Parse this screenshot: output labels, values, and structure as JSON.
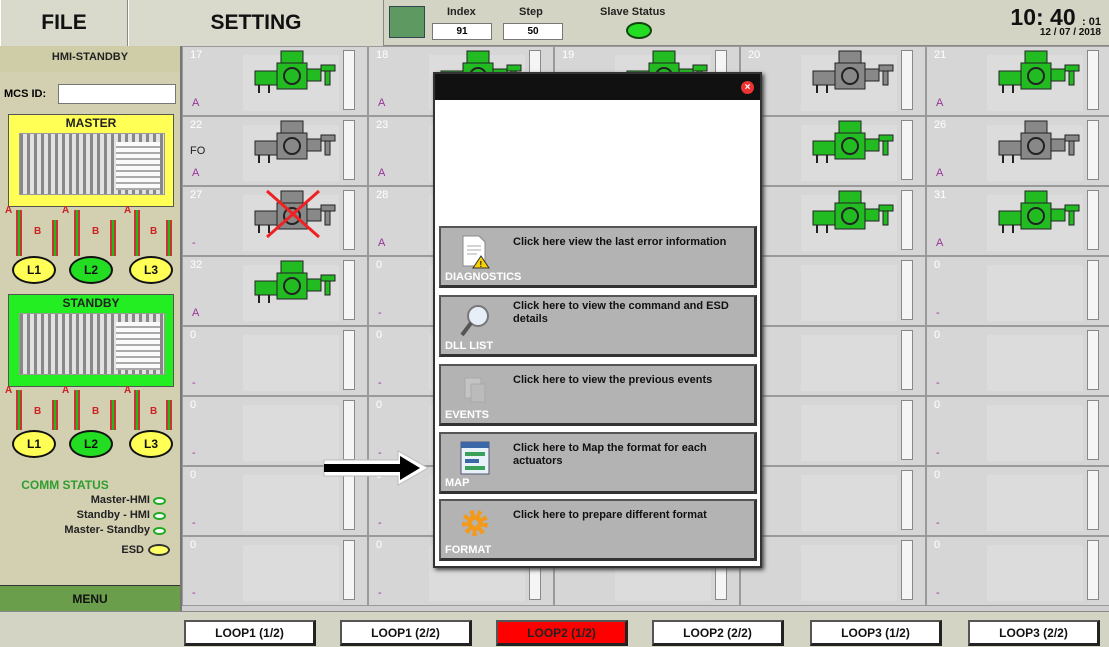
{
  "header": {
    "file_label": "FILE",
    "setting_label": "SETTING",
    "index_label": "Index",
    "index_value": "91",
    "step_label": "Step",
    "step_value": "50",
    "slave_status_label": "Slave Status",
    "time": "10: 40",
    "seconds": ": 01",
    "date": "12 / 07 / 2018"
  },
  "left_panel": {
    "title": "HMI-STANDBY",
    "mcs_label": "MCS ID:",
    "mcs_value": "",
    "master_label": "MASTER",
    "standby_label": "STANDBY",
    "a_label": "A",
    "b_label": "B",
    "loops": [
      "L1",
      "L2",
      "L3"
    ],
    "comm_status_title": "COMM STATUS",
    "comm_rows": [
      "Master-HMI",
      "Standby - HMI",
      "Master- Standby",
      "ESD"
    ],
    "menu_label": "MENU"
  },
  "grid": {
    "cells": [
      {
        "num": "17",
        "status": "A",
        "fo": "",
        "icon": "green"
      },
      {
        "num": "18",
        "status": "A",
        "fo": "",
        "icon": "green"
      },
      {
        "num": "19",
        "status": "",
        "fo": "",
        "icon": "green"
      },
      {
        "num": "20",
        "status": "",
        "fo": "",
        "icon": "gray"
      },
      {
        "num": "21",
        "status": "A",
        "fo": "",
        "icon": "green"
      },
      {
        "num": "22",
        "status": "A",
        "fo": "FO",
        "icon": "gray"
      },
      {
        "num": "23",
        "status": "A",
        "fo": "",
        "icon": ""
      },
      {
        "num": "",
        "status": "",
        "fo": "",
        "icon": ""
      },
      {
        "num": "",
        "status": "",
        "fo": "",
        "icon": "green"
      },
      {
        "num": "26",
        "status": "A",
        "fo": "",
        "icon": "gray"
      },
      {
        "num": "27",
        "status": "-",
        "fo": "",
        "icon": "crossed"
      },
      {
        "num": "28",
        "status": "A",
        "fo": "",
        "icon": ""
      },
      {
        "num": "",
        "status": "",
        "fo": "",
        "icon": ""
      },
      {
        "num": "",
        "status": "",
        "fo": "",
        "icon": "green"
      },
      {
        "num": "31",
        "status": "A",
        "fo": "",
        "icon": "green"
      },
      {
        "num": "32",
        "status": "A",
        "fo": "",
        "icon": "green"
      },
      {
        "num": "0",
        "status": "-",
        "fo": "",
        "icon": ""
      },
      {
        "num": "",
        "status": "",
        "fo": "",
        "icon": ""
      },
      {
        "num": "",
        "status": "",
        "fo": "",
        "icon": ""
      },
      {
        "num": "0",
        "status": "-",
        "fo": "",
        "icon": ""
      },
      {
        "num": "0",
        "status": "-",
        "fo": "",
        "icon": ""
      },
      {
        "num": "0",
        "status": "-",
        "fo": "",
        "icon": ""
      },
      {
        "num": "",
        "status": "",
        "fo": "",
        "icon": ""
      },
      {
        "num": "",
        "status": "",
        "fo": "",
        "icon": ""
      },
      {
        "num": "0",
        "status": "-",
        "fo": "",
        "icon": ""
      },
      {
        "num": "0",
        "status": "-",
        "fo": "",
        "icon": ""
      },
      {
        "num": "0",
        "status": "-",
        "fo": "",
        "icon": ""
      },
      {
        "num": "",
        "status": "",
        "fo": "",
        "icon": ""
      },
      {
        "num": "",
        "status": "",
        "fo": "",
        "icon": ""
      },
      {
        "num": "0",
        "status": "-",
        "fo": "",
        "icon": ""
      },
      {
        "num": "0",
        "status": "-",
        "fo": "",
        "icon": ""
      },
      {
        "num": "0",
        "status": "-",
        "fo": "",
        "icon": ""
      },
      {
        "num": "",
        "status": "",
        "fo": "",
        "icon": ""
      },
      {
        "num": "",
        "status": "",
        "fo": "",
        "icon": ""
      },
      {
        "num": "0",
        "status": "-",
        "fo": "",
        "icon": ""
      },
      {
        "num": "0",
        "status": "-",
        "fo": "",
        "icon": ""
      },
      {
        "num": "0",
        "status": "-",
        "fo": "",
        "icon": ""
      },
      {
        "num": "",
        "status": "",
        "fo": "",
        "icon": ""
      },
      {
        "num": "",
        "status": "",
        "fo": "",
        "icon": ""
      },
      {
        "num": "0",
        "status": "-",
        "fo": "",
        "icon": ""
      },
      {
        "num": "0",
        "status": "-",
        "fo": "",
        "icon": ""
      },
      {
        "num": "0",
        "status": "-",
        "fo": "",
        "icon": ""
      },
      {
        "num": "",
        "status": "-",
        "fo": "",
        "icon": ""
      },
      {
        "num": "",
        "status": "-",
        "fo": "",
        "icon": ""
      },
      {
        "num": "0",
        "status": "-",
        "fo": "",
        "icon": ""
      }
    ]
  },
  "popup": {
    "items": [
      {
        "name": "DIAGNOSTICS",
        "text": "Click here view the last error information",
        "icon": "document-warning-icon"
      },
      {
        "name": "DLL LIST",
        "text": "Click here to view the command and ESD details",
        "icon": "magnifier-icon"
      },
      {
        "name": "EVENTS",
        "text": "Click here to view the previous events",
        "icon": "events-icon"
      },
      {
        "name": "MAP",
        "text": "Click here to Map the format for each actuators",
        "icon": "map-icon"
      },
      {
        "name": "FORMAT",
        "text": "Click here to prepare different format",
        "icon": "gear-icon"
      }
    ]
  },
  "footer": {
    "loops": [
      "LOOP1 (1/2)",
      "LOOP1 (2/2)",
      "LOOP2 (1/2)",
      "LOOP2 (2/2)",
      "LOOP3 (1/2)",
      "LOOP3 (2/2)"
    ],
    "active_index": 2
  },
  "colors": {
    "active_loop": "#ff0000",
    "actuator_on": "#22bb22",
    "actuator_off": "#888888",
    "status_text": "#993399"
  }
}
